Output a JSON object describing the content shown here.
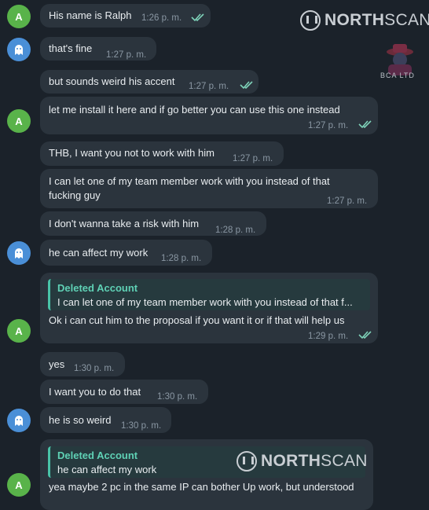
{
  "watermarks": {
    "brand_a": "NORTH",
    "brand_b": "SCAN",
    "badge": "BCA LTD"
  },
  "avatars": {
    "contact_a_letter": "A"
  },
  "messages": [
    {
      "text": "His name is Ralph",
      "time": "1:26 p. m.",
      "read": true
    },
    {
      "text": "that's fine",
      "time": "1:27 p. m."
    },
    {
      "text": "but sounds weird his accent",
      "time": "1:27 p. m.",
      "read": true
    },
    {
      "text": "let me install it here and if go better you can use this one instead",
      "time": "1:27 p. m.",
      "read": true
    },
    {
      "text": "THB, I want you not to work with him",
      "time": "1:27 p. m."
    },
    {
      "text_line1": "I can let one of my team member work with you instead of that",
      "text_line2": "fucking guy",
      "time": "1:27 p. m."
    },
    {
      "text": "I don't wanna take a risk with him",
      "time": "1:28 p. m."
    },
    {
      "text": "he can affect my work",
      "time": "1:28 p. m."
    },
    {
      "reply_name": "Deleted Account",
      "reply_text": "I can let one of my team member work with you instead of that f...",
      "text": "Ok i can cut him to the proposal if you want it or if that will help us",
      "time": "1:29 p. m.",
      "read": true
    },
    {
      "text": "yes",
      "time": "1:30 p. m."
    },
    {
      "text": "I want you to do that",
      "time": "1:30 p. m."
    },
    {
      "text": "he is so weird",
      "time": "1:30 p. m."
    },
    {
      "reply_name": "Deleted Account",
      "reply_text": "he can affect my work",
      "text": "yea maybe 2 pc in the same IP can bother Up work, but understood"
    }
  ],
  "colors": {
    "background": "#1b222a",
    "bubble": "#2b343d",
    "accent_green": "#59b34a",
    "accent_blue": "#4a8fd7",
    "reply_accent": "#49c3a8"
  }
}
